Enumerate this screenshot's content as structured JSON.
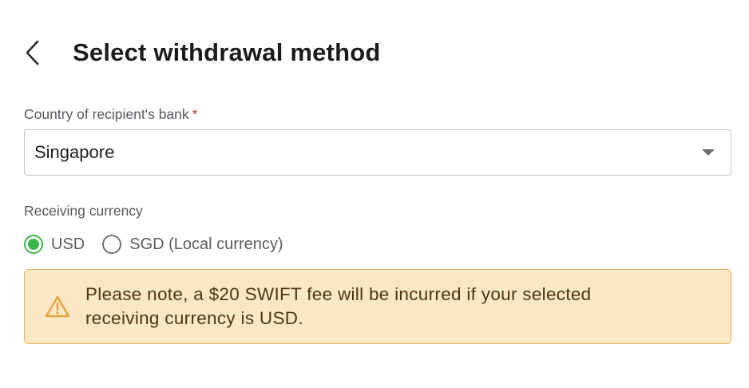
{
  "header": {
    "title": "Select withdrawal method"
  },
  "country_field": {
    "label": "Country of recipient's bank",
    "required_marker": "*",
    "value": "Singapore"
  },
  "currency_field": {
    "label": "Receiving currency",
    "options": [
      {
        "label": "USD",
        "selected": true
      },
      {
        "label": "SGD (Local currency)",
        "selected": false
      }
    ]
  },
  "alert": {
    "icon": "warning-icon",
    "message": "Please note, a $20 SWIFT fee will be incurred if your selected receiving currency is USD."
  },
  "colors": {
    "accent_green": "#3cb54a",
    "alert_background": "#fbe8c4",
    "alert_border": "#e6b45a",
    "required_red": "#c0392b"
  }
}
